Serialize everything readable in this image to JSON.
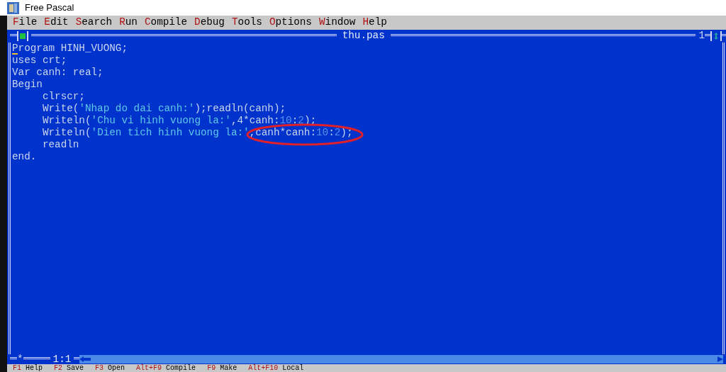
{
  "window": {
    "title": "Free Pascal"
  },
  "menu": [
    {
      "label": "File"
    },
    {
      "label": "Edit"
    },
    {
      "label": "Search"
    },
    {
      "label": "Run"
    },
    {
      "label": "Compile"
    },
    {
      "label": "Debug"
    },
    {
      "label": "Tools"
    },
    {
      "label": "Options"
    },
    {
      "label": "Window"
    },
    {
      "label": "Help"
    }
  ],
  "editor": {
    "file_name": "thu.pas",
    "window_number": "1",
    "modified_mark": "*",
    "cursor_position": "1:1",
    "lines": [
      [
        {
          "kind": "code",
          "text": "Program HINH_VUONG;"
        }
      ],
      [
        {
          "kind": "code",
          "text": "uses crt;"
        }
      ],
      [
        {
          "kind": "code",
          "text": "Var canh: real;"
        }
      ],
      [
        {
          "kind": "code",
          "text": "Begin"
        }
      ],
      [
        {
          "kind": "code",
          "text": "     clrscr;"
        }
      ],
      [
        {
          "kind": "code",
          "text": "     Write("
        },
        {
          "kind": "string",
          "text": "'Nhap do dai canh:'"
        },
        {
          "kind": "code",
          "text": ");readln(canh);"
        }
      ],
      [
        {
          "kind": "code",
          "text": "     Writeln("
        },
        {
          "kind": "string",
          "text": "'Chu vi hinh vuong la:'"
        },
        {
          "kind": "code",
          "text": ",4*canh:"
        },
        {
          "kind": "number",
          "text": "10"
        },
        {
          "kind": "code",
          "text": ":"
        },
        {
          "kind": "number",
          "text": "2"
        },
        {
          "kind": "code",
          "text": ");"
        }
      ],
      [
        {
          "kind": "code",
          "text": "     Writeln("
        },
        {
          "kind": "string",
          "text": "'Dien tich hinh vuong la:'"
        },
        {
          "kind": "code",
          "text": ",canh*canh:"
        },
        {
          "kind": "number",
          "text": "10"
        },
        {
          "kind": "code",
          "text": ":"
        },
        {
          "kind": "number",
          "text": "2"
        },
        {
          "kind": "code",
          "text": ");"
        }
      ],
      [
        {
          "kind": "code",
          "text": "     readln"
        }
      ],
      [
        {
          "kind": "code",
          "text": "end."
        }
      ]
    ]
  },
  "status_bar": [
    {
      "key": "F1",
      "label": "Help"
    },
    {
      "key": "F2",
      "label": "Save"
    },
    {
      "key": "F3",
      "label": "Open"
    },
    {
      "key": "Alt+F9",
      "label": "Compile"
    },
    {
      "key": "F9",
      "label": "Make"
    },
    {
      "key": "Alt+F10",
      "label": "Local"
    }
  ]
}
